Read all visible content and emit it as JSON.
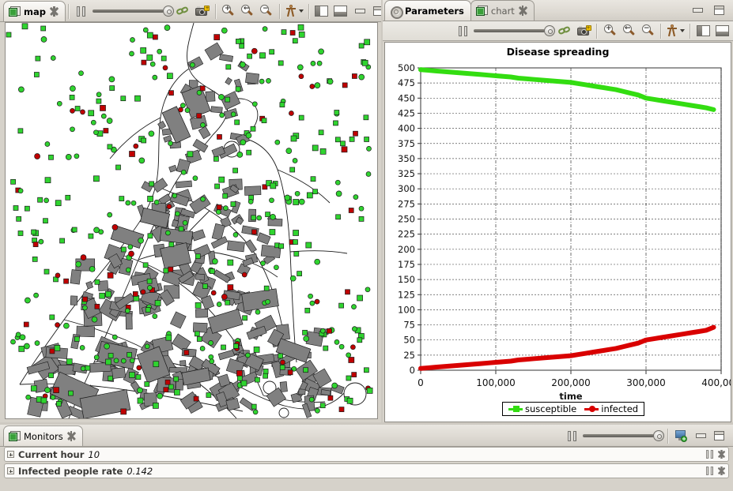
{
  "left_panel": {
    "tab": {
      "label": "map",
      "icon": "view-icon",
      "close_icon": "close-icon"
    },
    "toolbar": {
      "pause_label": "pause-simulation",
      "slider_label": "speed-slider",
      "link_label": "synchronize-views",
      "snapshot_label": "take-snapshot",
      "zoom_in_label": "zoom-in",
      "zoom_fit_label": "zoom-fit",
      "zoom_out_label": "zoom-out",
      "agents_label": "agents-menu",
      "layout_left_label": "layout-side",
      "layout_bottom_label": "layout-bottom",
      "minimize_label": "minimize",
      "maximize_label": "maximize"
    }
  },
  "right_panel": {
    "tabs": [
      {
        "label": "Parameters",
        "icon": "gear-icon",
        "active": false
      },
      {
        "label": "chart",
        "icon": "view-icon",
        "active": true,
        "closable": true
      }
    ],
    "toolbar": {
      "pause_label": "pause-simulation",
      "slider_label": "speed-slider",
      "link_label": "synchronize-views",
      "snapshot_label": "take-snapshot",
      "zoom_in_label": "zoom-in",
      "zoom_fit_label": "zoom-fit",
      "zoom_out_label": "zoom-out",
      "agents_label": "agents-menu",
      "layout_left_label": "layout-side",
      "layout_bottom_label": "layout-bottom"
    },
    "window_controls": {
      "minimize_label": "minimize",
      "maximize_label": "maximize"
    }
  },
  "bottom_panel": {
    "tab": {
      "label": "Monitors",
      "icon": "view-icon",
      "close_icon": "close-icon"
    },
    "toolbar": {
      "pause_label": "pause-monitors",
      "slider_label": "refresh-slider",
      "add_monitor_label": "add-monitor",
      "minimize_label": "minimize",
      "maximize_label": "maximize"
    },
    "monitors": [
      {
        "name": "Current hour",
        "value": "10"
      },
      {
        "name": "Infected people rate",
        "value": "0.142"
      }
    ]
  },
  "chart_data": {
    "type": "line",
    "title": "Disease spreading",
    "xlabel": "time",
    "ylabel": "",
    "xlim": [
      0,
      400000
    ],
    "ylim": [
      0,
      500
    ],
    "xticks": [
      0,
      100000,
      200000,
      300000,
      400000
    ],
    "xtick_labels": [
      "0",
      "100,000",
      "200,000",
      "300,000",
      "400,000"
    ],
    "yticks": [
      0,
      25,
      50,
      75,
      100,
      125,
      150,
      175,
      200,
      225,
      250,
      275,
      300,
      325,
      350,
      375,
      400,
      425,
      450,
      475,
      500
    ],
    "ytick_labels": [
      "0",
      "25",
      "50",
      "75",
      "100",
      "125",
      "150",
      "175",
      "200",
      "225",
      "250",
      "275",
      "300",
      "325",
      "350",
      "375",
      "400",
      "425",
      "450",
      "475",
      "500"
    ],
    "grid": true,
    "legend_position": "bottom",
    "colors": {
      "susceptible": "#33dd11",
      "infected": "#d90000"
    },
    "series": [
      {
        "name": "susceptible",
        "color": "#33dd11",
        "x": [
          0,
          10000,
          20000,
          30000,
          40000,
          50000,
          60000,
          70000,
          80000,
          90000,
          100000,
          110000,
          120000,
          130000,
          140000,
          150000,
          160000,
          170000,
          180000,
          190000,
          200000,
          210000,
          220000,
          230000,
          240000,
          250000,
          260000,
          270000,
          280000,
          290000,
          300000,
          310000,
          320000,
          330000,
          340000,
          350000,
          360000,
          370000,
          380000,
          390000
        ],
        "values": [
          497,
          496,
          495,
          494,
          493,
          492,
          491,
          490,
          489,
          488,
          487,
          486,
          485,
          483,
          482,
          481,
          480,
          479,
          478,
          477,
          476,
          474,
          472,
          470,
          468,
          466,
          464,
          461,
          458,
          455,
          450,
          448,
          446,
          444,
          442,
          440,
          438,
          436,
          434,
          431
        ]
      },
      {
        "name": "infected",
        "color": "#d90000",
        "x": [
          0,
          10000,
          20000,
          30000,
          40000,
          50000,
          60000,
          70000,
          80000,
          90000,
          100000,
          110000,
          120000,
          130000,
          140000,
          150000,
          160000,
          170000,
          180000,
          190000,
          200000,
          210000,
          220000,
          230000,
          240000,
          250000,
          260000,
          270000,
          280000,
          290000,
          300000,
          310000,
          320000,
          330000,
          340000,
          350000,
          360000,
          370000,
          380000,
          390000
        ],
        "values": [
          3,
          4,
          5,
          6,
          7,
          8,
          9,
          10,
          11,
          12,
          13,
          14,
          15,
          17,
          18,
          19,
          20,
          21,
          22,
          23,
          24,
          26,
          28,
          30,
          32,
          34,
          36,
          39,
          42,
          45,
          50,
          52,
          54,
          56,
          58,
          60,
          62,
          64,
          66,
          71
        ]
      }
    ]
  }
}
